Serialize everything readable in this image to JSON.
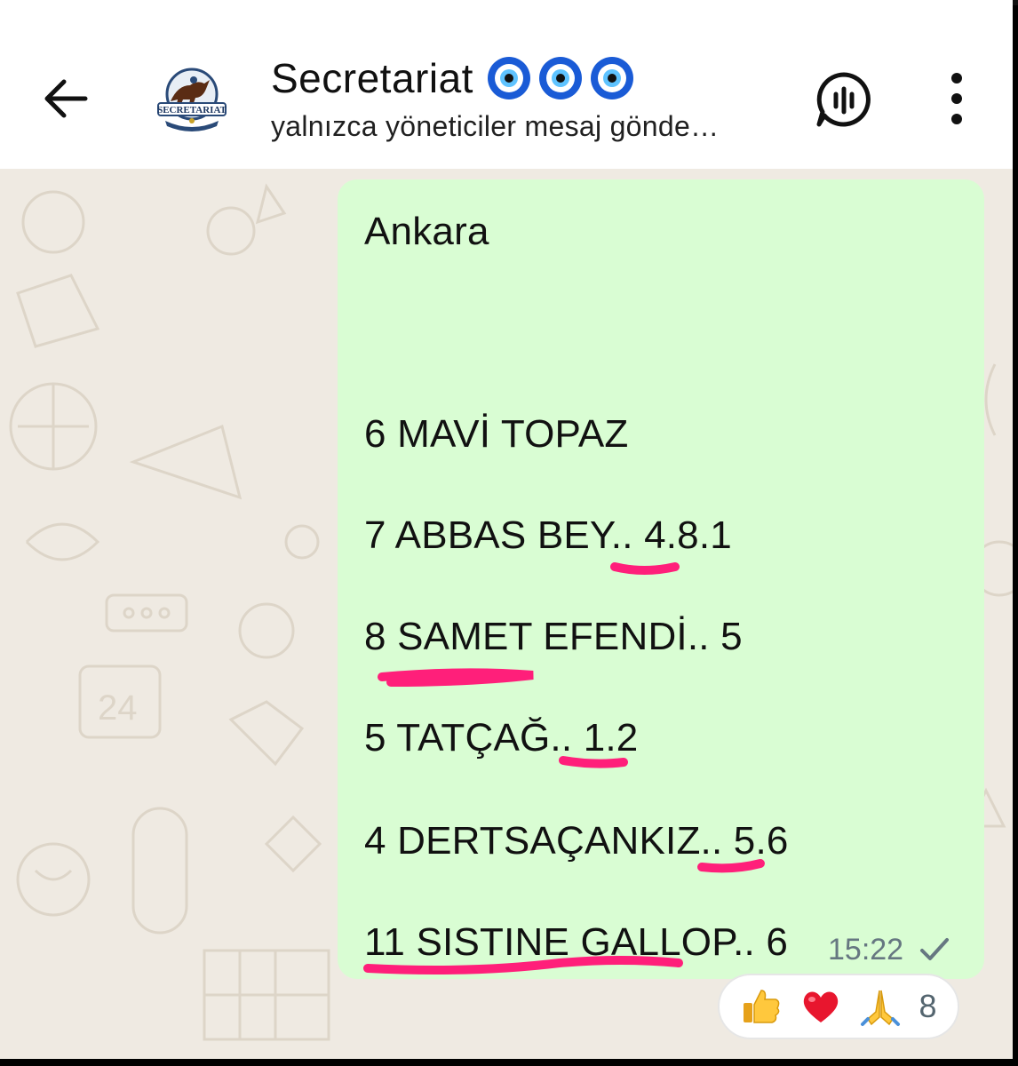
{
  "header": {
    "title": "Secretariat",
    "subtitle": "yalnızca yöneticiler mesaj gönde…",
    "avatar_text": "SECRETARIAT",
    "title_emoji": [
      "nazar-amulet",
      "nazar-amulet",
      "nazar-amulet"
    ]
  },
  "icons": {
    "back": "arrow-left-icon",
    "voice": "voice-chat-icon",
    "menu": "more-vertical-icon"
  },
  "message": {
    "lines": [
      "Ankara",
      "6 MAVİ TOPAZ",
      "7 ABBAS BEY.. 4.8.1",
      "8 SAMET EFENDİ.. 5",
      "5 TATÇAĞ.. 1.2",
      "4 DERTSAÇANKIZ.. 5.6",
      "11 SISTINE GALLOP.. 6"
    ],
    "time": "15:22",
    "status": "sent",
    "bubble_color": "#d9fdd3",
    "highlight_color": "#ff1f7a"
  },
  "reactions": {
    "emojis": [
      "thumbs-up",
      "red-heart",
      "folded-hands"
    ],
    "count": "8"
  },
  "colors": {
    "wallpaper": "#efeae2",
    "header_bg": "#ffffff"
  }
}
